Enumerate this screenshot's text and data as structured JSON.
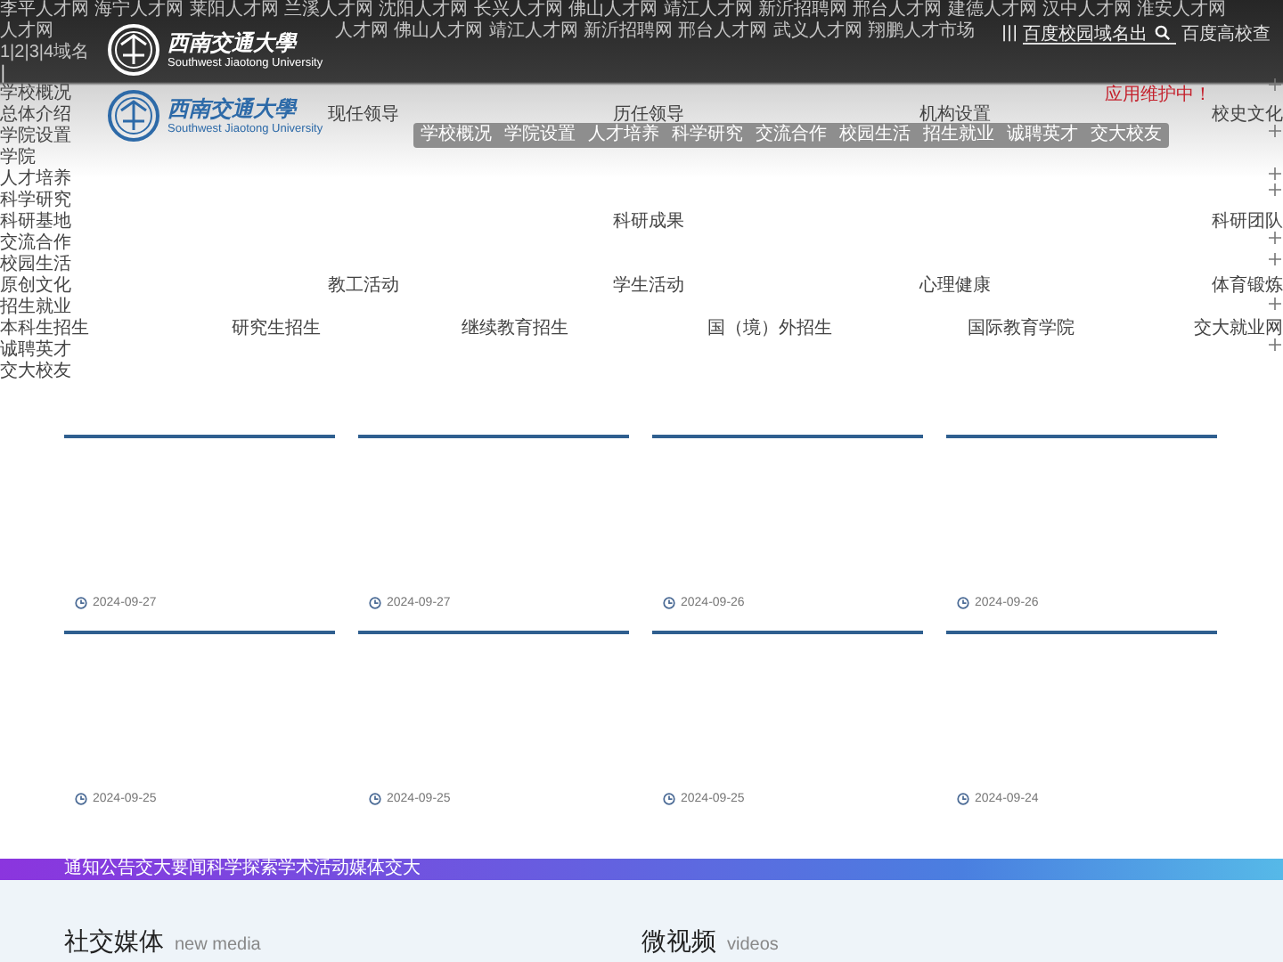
{
  "ticker": {
    "line_1": "李平人才网 海宁人才网 莱阳人才网 兰溪人才网 沈阳人才网 长兴人才网 佛山人才网 靖江人才网 新沂招聘网 邢台人才网 建德人才网 汉中人才网 淮安人才网",
    "line_2_start": "人才网",
    "line_2": "人才网 佛山人才网 靖江人才网 新沂招聘网 邢台人才网 武义人才网 翔鹏人才市场"
  },
  "pager": "1|2|3|4域名",
  "divider_mark": "|",
  "search": {
    "menu_glyph": "|||",
    "value": "百度校园域名出",
    "trailing_text": "百度高校查"
  },
  "notice": "应用维护中！",
  "logos": [
    {
      "name": "西南交通大學",
      "subtitle": "Southwest Jiaotong University",
      "kind": "white"
    },
    {
      "name": "西南交通大學",
      "subtitle": "Southwest Jiaotong University",
      "kind": "blue"
    }
  ],
  "nav": [
    "学校概况",
    "学院设置",
    "人才培养",
    "科学研究",
    "交流合作",
    "校园生活",
    "招生就业",
    "诚聘英才",
    "交大校友"
  ],
  "menu_rows": [
    {
      "items": [
        "学校概况"
      ]
    },
    {
      "items": [
        "总体介绍",
        "现任领导",
        "历任领导",
        "机构设置",
        "校史文化"
      ]
    },
    {
      "items": [
        "学院设置"
      ]
    },
    {
      "items": [
        "学院"
      ]
    },
    {
      "items": [
        "人才培养"
      ]
    },
    {
      "items": [
        "科学研究"
      ]
    },
    {
      "items": [
        "科研基地",
        "科研成果",
        "科研团队"
      ]
    },
    {
      "items": [
        "交流合作"
      ]
    },
    {
      "items": [
        "校园生活"
      ]
    },
    {
      "items": [
        "原创文化",
        "教工活动",
        "学生活动",
        "心理健康",
        "体育锻炼"
      ]
    },
    {
      "items": [
        "招生就业"
      ]
    },
    {
      "items": [
        "本科生招生",
        "研究生招生",
        "继续教育招生",
        "国（境）外招生",
        "国际教育学院",
        "交大就业网"
      ]
    },
    {
      "items": [
        "诚聘英才"
      ]
    },
    {
      "items": [
        "交大校友"
      ]
    }
  ],
  "cards": [
    {
      "date": "2024-09-27"
    },
    {
      "date": "2024-09-27"
    },
    {
      "date": "2024-09-26"
    },
    {
      "date": "2024-09-26"
    },
    {
      "date": "2024-09-25"
    },
    {
      "date": "2024-09-25"
    },
    {
      "date": "2024-09-25"
    },
    {
      "date": "2024-09-24"
    }
  ],
  "band": {
    "text": "通知公告交大要闻科学探索学术活动媒体交大"
  },
  "sections": [
    {
      "title": "社交媒体",
      "subtitle": "new media"
    },
    {
      "title": "微视频",
      "subtitle": "videos"
    }
  ]
}
